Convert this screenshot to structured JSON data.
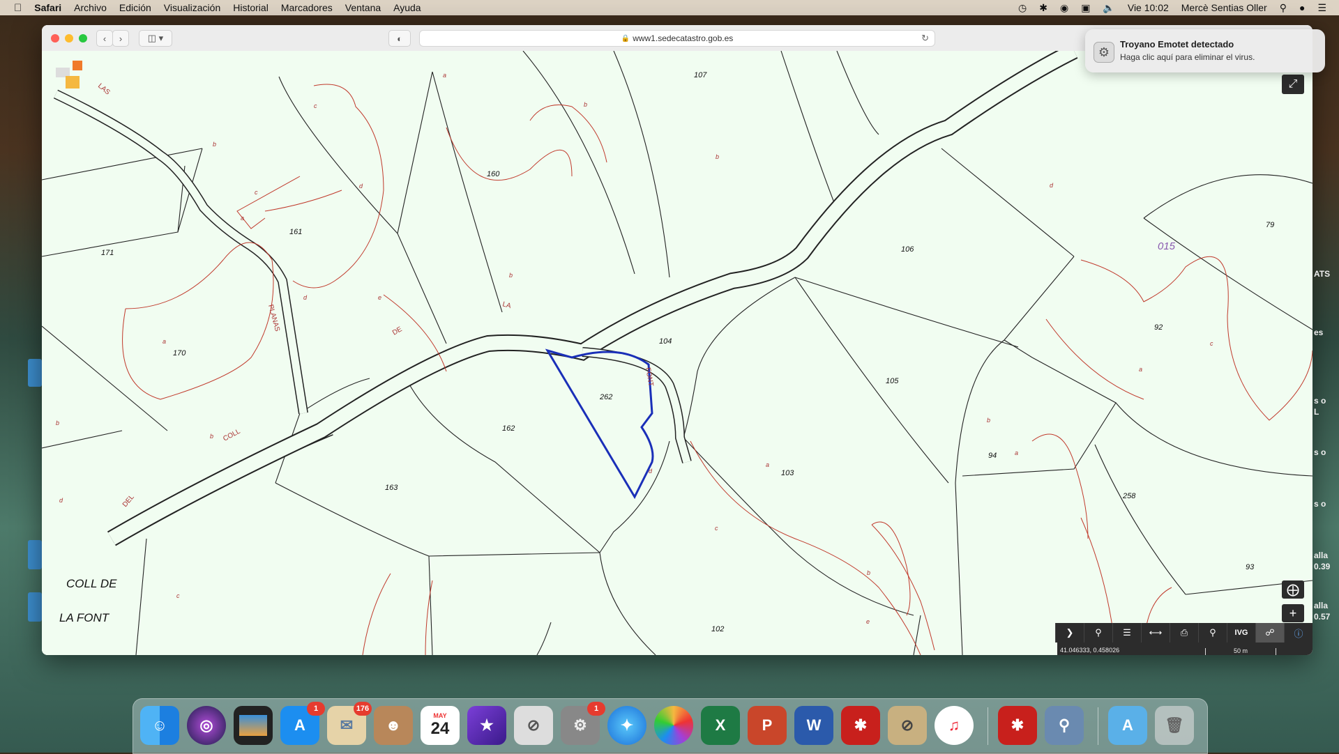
{
  "menubar": {
    "app_name": "Safari",
    "menus": [
      "Archivo",
      "Edición",
      "Visualización",
      "Historial",
      "Marcadores",
      "Ventana",
      "Ayuda"
    ],
    "clock": "Vie 10:02",
    "user": "Mercè Sentias Oller"
  },
  "browser": {
    "url": "www1.sedecatastro.gob.es"
  },
  "notification": {
    "title": "Troyano Emotet detectado",
    "body": "Haga clic aquí para eliminar el virus."
  },
  "map": {
    "parcel_labels": [
      "107",
      "160",
      "161",
      "171",
      "170",
      "162",
      "163",
      "262",
      "104",
      "106",
      "105",
      "103",
      "102",
      "94",
      "258",
      "93",
      "92",
      "79"
    ],
    "subparcel_labels": [
      "a",
      "b",
      "c",
      "d",
      "e"
    ],
    "road_labels": [
      "LAS",
      "PLANAS",
      "DE",
      "LA",
      "FONT",
      "COLL",
      "DEL"
    ],
    "zone_label": "015",
    "place_name_line1": "COLL DE",
    "place_name_line2": "LA FONT",
    "coordinates": "41.046333, 0.458026",
    "scale": "50 m",
    "toolbar": {
      "ivg": "IVG"
    },
    "accent_color": "#1a2fb8",
    "subparcel_line_color": "#c0392b"
  },
  "peek": [
    "ATS",
    "es",
    "s o",
    "L",
    "s o",
    "s o",
    "alla",
    "0.39",
    "alla",
    "0.57"
  ],
  "dock": {
    "appstore_badge": "1",
    "mail_badge": "176",
    "calendar_month": "MAY",
    "calendar_day": "24",
    "prefs_badge": "1",
    "excel_letter": "X",
    "powerpoint_letter": "P",
    "word_letter": "W"
  }
}
